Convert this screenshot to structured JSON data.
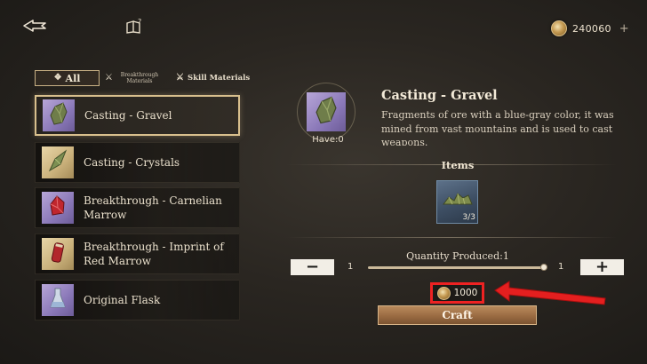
{
  "topbar": {
    "back_icon": "back-arrow-icon",
    "help_icon": "help-book-icon",
    "currency_value": "240060",
    "currency_plus": "+"
  },
  "filters": [
    {
      "label": "All",
      "icon": "diamond-icon",
      "active": true
    },
    {
      "label": "Breakthrough Materials",
      "icon": "crossed-swords-icon",
      "active": false
    },
    {
      "label": "Skill Materials",
      "icon": "crossed-swords-icon",
      "active": false
    }
  ],
  "items": [
    {
      "label": "Casting - Gravel",
      "thumb": "purple",
      "icon": "gravel-icon",
      "selected": true
    },
    {
      "label": "Casting - Crystals",
      "thumb": "gold",
      "icon": "crystal-icon",
      "selected": false
    },
    {
      "label": "Breakthrough - Carnelian Marrow",
      "thumb": "purple",
      "icon": "carnelian-icon",
      "selected": false
    },
    {
      "label": "Breakthrough - Imprint of Red Marrow",
      "thumb": "gold",
      "icon": "red-marrow-icon",
      "selected": false
    },
    {
      "label": "Original Flask",
      "thumb": "purple",
      "icon": "flask-icon",
      "selected": false
    }
  ],
  "detail": {
    "title": "Casting - Gravel",
    "description": "Fragments of ore with a blue-gray color, it was mined from vast mountains and is used to cast weapons.",
    "have": "Have:0",
    "items_label": "Items",
    "material_count": "3/3",
    "quantity_label": "Quantity Produced:1",
    "qty_min": "1",
    "qty_max": "1",
    "qty_fraction": 1.0,
    "cost": "1000",
    "craft_label": "Craft"
  },
  "colors": {
    "accent_gold": "#d8bf8d",
    "rare_purple": "#8a78b8",
    "highlight_red": "#e22222",
    "craft_button": "#9a6b42"
  }
}
